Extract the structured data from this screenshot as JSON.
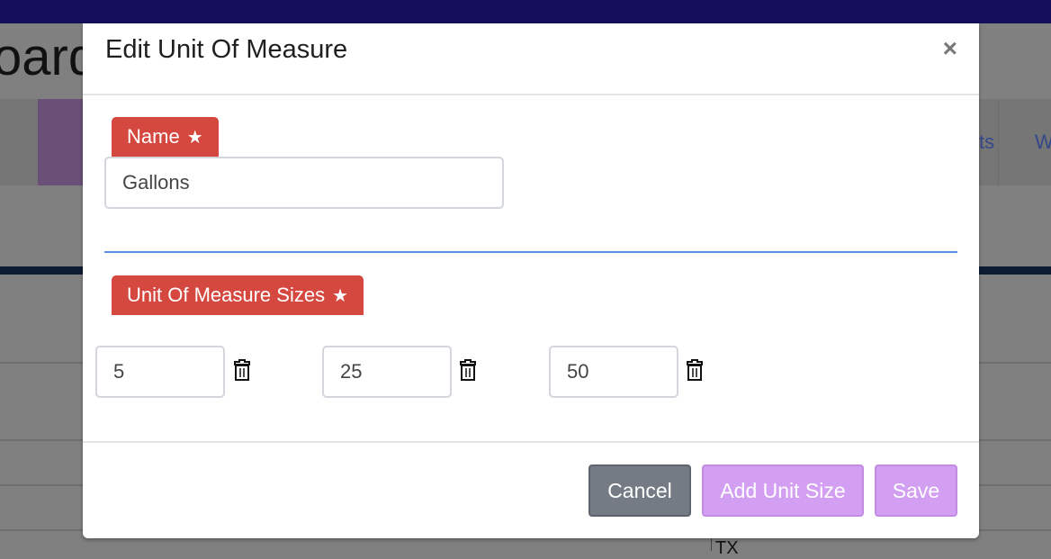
{
  "background": {
    "title_fragment": "oard",
    "nav_fragment_1": "ts",
    "nav_fragment_2": "W",
    "cell_fragment": "TX"
  },
  "modal": {
    "title": "Edit Unit Of Measure",
    "close_icon": "×",
    "name_label": "Name",
    "name_value": "Gallons",
    "sizes_label": "Unit Of Measure Sizes",
    "required_icon": "star-icon",
    "sizes": [
      "5",
      "25",
      "50"
    ],
    "buttons": {
      "cancel": "Cancel",
      "add_unit_size": "Add Unit Size",
      "save": "Save"
    }
  },
  "colors": {
    "badge": "#d4483f",
    "primary_button": "#d39ff2",
    "cancel_button": "#747b85",
    "topbar": "#140d5c"
  }
}
